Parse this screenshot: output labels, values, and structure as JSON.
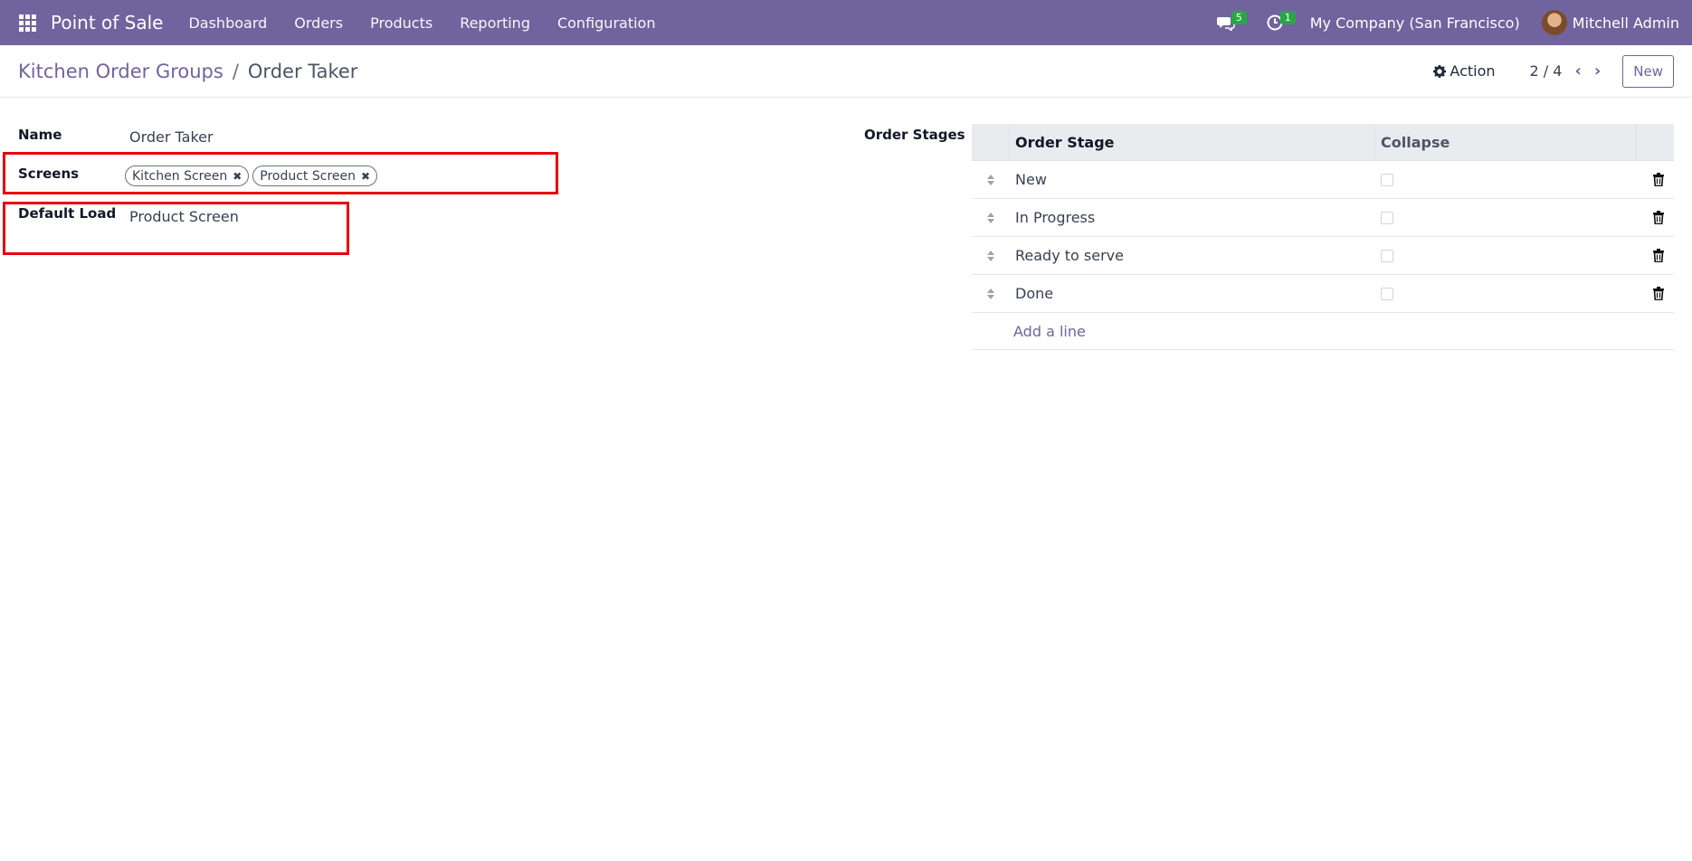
{
  "navbar": {
    "brand": "Point of Sale",
    "menu": [
      "Dashboard",
      "Orders",
      "Products",
      "Reporting",
      "Configuration"
    ],
    "messages_badge": "5",
    "activities_badge": "1",
    "company": "My Company (San Francisco)",
    "user": "Mitchell Admin"
  },
  "control_panel": {
    "breadcrumb_parent": "Kitchen Order Groups",
    "breadcrumb_separator": "/",
    "breadcrumb_current": "Order Taker",
    "action_label": "Action",
    "pager": "2 / 4",
    "new_label": "New"
  },
  "form": {
    "name_label": "Name",
    "name_value": "Order Taker",
    "screens_label": "Screens",
    "screens_tags": [
      "Kitchen Screen",
      "Product Screen"
    ],
    "default_load_label": "Default Load",
    "default_load_value": "Product Screen",
    "order_stages_label": "Order Stages"
  },
  "table": {
    "headers": {
      "stage": "Order Stage",
      "collapse": "Collapse"
    },
    "rows": [
      {
        "stage": "New",
        "collapse": false
      },
      {
        "stage": "In Progress",
        "collapse": false
      },
      {
        "stage": "Ready to serve",
        "collapse": false
      },
      {
        "stage": "Done",
        "collapse": false
      }
    ],
    "add_line": "Add a line"
  },
  "colors": {
    "brand": "#71639e",
    "highlight": "#e8000b",
    "badge": "#28a745"
  }
}
